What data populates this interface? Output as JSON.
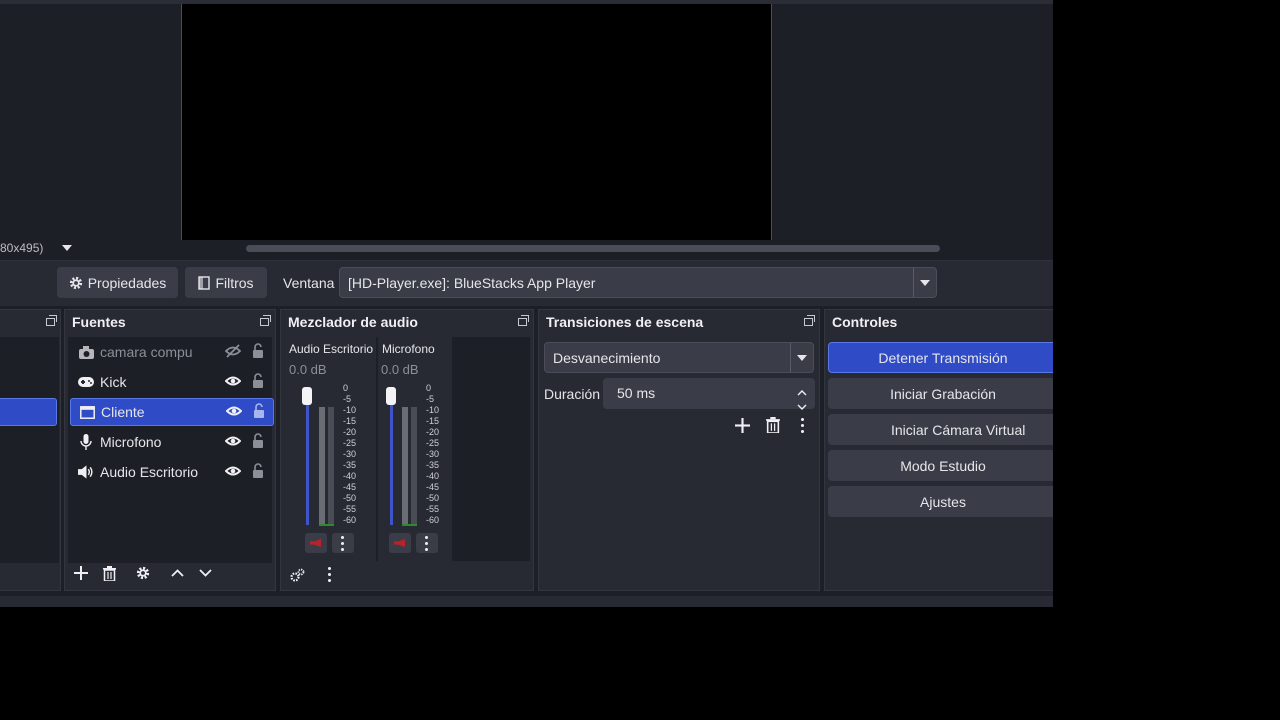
{
  "preview": {
    "resolution_text": "80x495)"
  },
  "toolbar": {
    "properties_label": "Propiedades",
    "filters_label": "Filtros",
    "window_label": "Ventana",
    "window_value": "[HD-Player.exe]: BlueStacks App Player"
  },
  "sources": {
    "title": "Fuentes",
    "items": [
      {
        "label": "camara compu",
        "icon": "camera-icon",
        "visible": false
      },
      {
        "label": "Kick",
        "icon": "gamepad-icon",
        "visible": true
      },
      {
        "label": "Cliente",
        "icon": "window-icon",
        "visible": true,
        "selected": true
      },
      {
        "label": "Microfono",
        "icon": "microphone-icon",
        "visible": true
      },
      {
        "label": "Audio Escritorio",
        "icon": "speaker-icon",
        "visible": true
      }
    ]
  },
  "mixer": {
    "title": "Mezclador de audio",
    "channels": [
      {
        "name": "Audio Escritorio",
        "db": "0.0 dB"
      },
      {
        "name": "Microfono",
        "db": "0.0 dB"
      }
    ],
    "ticks": [
      "0",
      "-5",
      "-10",
      "-15",
      "-20",
      "-25",
      "-30",
      "-35",
      "-40",
      "-45",
      "-50",
      "-55",
      "-60"
    ]
  },
  "transitions": {
    "title": "Transiciones de escena",
    "selected": "Desvanecimiento",
    "duration_label": "Duración",
    "duration_value": "50 ms"
  },
  "controls": {
    "title": "Controles",
    "buttons": [
      "Detener Transmisión",
      "Iniciar Grabación",
      "Iniciar Cámara Virtual",
      "Modo Estudio",
      "Ajustes"
    ]
  },
  "colors": {
    "accent": "#2f4bc6",
    "panel": "#272a33",
    "background": "#1d1f26"
  }
}
